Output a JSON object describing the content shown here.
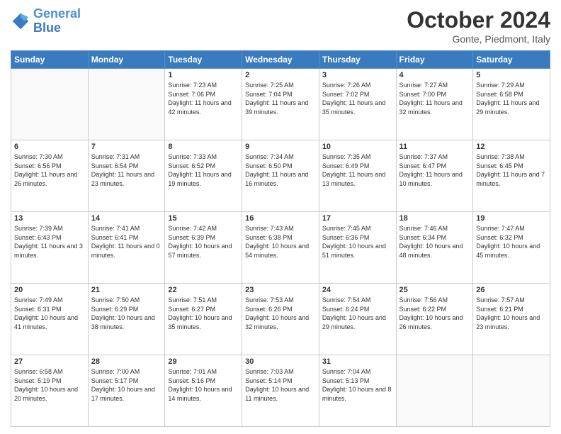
{
  "header": {
    "logo_general": "General",
    "logo_blue": "Blue",
    "month_title": "October 2024",
    "location": "Gonte, Piedmont, Italy"
  },
  "days_of_week": [
    "Sunday",
    "Monday",
    "Tuesday",
    "Wednesday",
    "Thursday",
    "Friday",
    "Saturday"
  ],
  "weeks": [
    [
      {
        "day": "",
        "info": ""
      },
      {
        "day": "",
        "info": ""
      },
      {
        "day": "1",
        "info": "Sunrise: 7:23 AM\nSunset: 7:06 PM\nDaylight: 11 hours and 42 minutes."
      },
      {
        "day": "2",
        "info": "Sunrise: 7:25 AM\nSunset: 7:04 PM\nDaylight: 11 hours and 39 minutes."
      },
      {
        "day": "3",
        "info": "Sunrise: 7:26 AM\nSunset: 7:02 PM\nDaylight: 11 hours and 35 minutes."
      },
      {
        "day": "4",
        "info": "Sunrise: 7:27 AM\nSunset: 7:00 PM\nDaylight: 11 hours and 32 minutes."
      },
      {
        "day": "5",
        "info": "Sunrise: 7:29 AM\nSunset: 6:58 PM\nDaylight: 11 hours and 29 minutes."
      }
    ],
    [
      {
        "day": "6",
        "info": "Sunrise: 7:30 AM\nSunset: 6:56 PM\nDaylight: 11 hours and 26 minutes."
      },
      {
        "day": "7",
        "info": "Sunrise: 7:31 AM\nSunset: 6:54 PM\nDaylight: 11 hours and 23 minutes."
      },
      {
        "day": "8",
        "info": "Sunrise: 7:33 AM\nSunset: 6:52 PM\nDaylight: 11 hours and 19 minutes."
      },
      {
        "day": "9",
        "info": "Sunrise: 7:34 AM\nSunset: 6:50 PM\nDaylight: 11 hours and 16 minutes."
      },
      {
        "day": "10",
        "info": "Sunrise: 7:35 AM\nSunset: 6:49 PM\nDaylight: 11 hours and 13 minutes."
      },
      {
        "day": "11",
        "info": "Sunrise: 7:37 AM\nSunset: 6:47 PM\nDaylight: 11 hours and 10 minutes."
      },
      {
        "day": "12",
        "info": "Sunrise: 7:38 AM\nSunset: 6:45 PM\nDaylight: 11 hours and 7 minutes."
      }
    ],
    [
      {
        "day": "13",
        "info": "Sunrise: 7:39 AM\nSunset: 6:43 PM\nDaylight: 11 hours and 3 minutes."
      },
      {
        "day": "14",
        "info": "Sunrise: 7:41 AM\nSunset: 6:41 PM\nDaylight: 11 hours and 0 minutes."
      },
      {
        "day": "15",
        "info": "Sunrise: 7:42 AM\nSunset: 6:39 PM\nDaylight: 10 hours and 57 minutes."
      },
      {
        "day": "16",
        "info": "Sunrise: 7:43 AM\nSunset: 6:38 PM\nDaylight: 10 hours and 54 minutes."
      },
      {
        "day": "17",
        "info": "Sunrise: 7:45 AM\nSunset: 6:36 PM\nDaylight: 10 hours and 51 minutes."
      },
      {
        "day": "18",
        "info": "Sunrise: 7:46 AM\nSunset: 6:34 PM\nDaylight: 10 hours and 48 minutes."
      },
      {
        "day": "19",
        "info": "Sunrise: 7:47 AM\nSunset: 6:32 PM\nDaylight: 10 hours and 45 minutes."
      }
    ],
    [
      {
        "day": "20",
        "info": "Sunrise: 7:49 AM\nSunset: 6:31 PM\nDaylight: 10 hours and 41 minutes."
      },
      {
        "day": "21",
        "info": "Sunrise: 7:50 AM\nSunset: 6:29 PM\nDaylight: 10 hours and 38 minutes."
      },
      {
        "day": "22",
        "info": "Sunrise: 7:51 AM\nSunset: 6:27 PM\nDaylight: 10 hours and 35 minutes."
      },
      {
        "day": "23",
        "info": "Sunrise: 7:53 AM\nSunset: 6:26 PM\nDaylight: 10 hours and 32 minutes."
      },
      {
        "day": "24",
        "info": "Sunrise: 7:54 AM\nSunset: 6:24 PM\nDaylight: 10 hours and 29 minutes."
      },
      {
        "day": "25",
        "info": "Sunrise: 7:56 AM\nSunset: 6:22 PM\nDaylight: 10 hours and 26 minutes."
      },
      {
        "day": "26",
        "info": "Sunrise: 7:57 AM\nSunset: 6:21 PM\nDaylight: 10 hours and 23 minutes."
      }
    ],
    [
      {
        "day": "27",
        "info": "Sunrise: 6:58 AM\nSunset: 5:19 PM\nDaylight: 10 hours and 20 minutes."
      },
      {
        "day": "28",
        "info": "Sunrise: 7:00 AM\nSunset: 5:17 PM\nDaylight: 10 hours and 17 minutes."
      },
      {
        "day": "29",
        "info": "Sunrise: 7:01 AM\nSunset: 5:16 PM\nDaylight: 10 hours and 14 minutes."
      },
      {
        "day": "30",
        "info": "Sunrise: 7:03 AM\nSunset: 5:14 PM\nDaylight: 10 hours and 11 minutes."
      },
      {
        "day": "31",
        "info": "Sunrise: 7:04 AM\nSunset: 5:13 PM\nDaylight: 10 hours and 8 minutes."
      },
      {
        "day": "",
        "info": ""
      },
      {
        "day": "",
        "info": ""
      }
    ]
  ]
}
